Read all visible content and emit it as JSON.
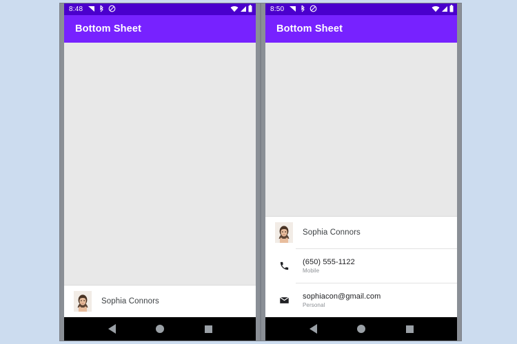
{
  "background_color": "#ccdcef",
  "theme": {
    "appbar_color": "#7722ff",
    "statusbar_color": "#4a00cc",
    "sheet_color": "#ffffff",
    "content_color": "#e8e8e8",
    "navbar_color": "#000000",
    "nav_icon_color": "#9aa0a6",
    "primary_text_color": "#202124",
    "secondary_text_color": "#8b8f94"
  },
  "phones": [
    {
      "id": "collapsed",
      "status_bar": {
        "clock": "8:48",
        "left_icons": [
          "signal-flag-icon",
          "bluetooth-icon",
          "do-not-disturb-icon"
        ],
        "right_icons": [
          "wifi-icon",
          "cellular-signal-icon",
          "battery-icon"
        ]
      },
      "app_bar": {
        "title": "Bottom Sheet"
      },
      "bottom_sheet": {
        "state": "collapsed",
        "contact": {
          "name": "Sophia Connors",
          "avatar": "contact-photo"
        },
        "details": []
      },
      "nav_bar": {
        "back_label": "Back",
        "home_label": "Home",
        "recents_label": "Recents"
      }
    },
    {
      "id": "expanded",
      "status_bar": {
        "clock": "8:50",
        "left_icons": [
          "signal-flag-icon",
          "bluetooth-icon",
          "do-not-disturb-icon"
        ],
        "right_icons": [
          "wifi-icon",
          "cellular-signal-icon",
          "battery-icon"
        ]
      },
      "app_bar": {
        "title": "Bottom Sheet"
      },
      "bottom_sheet": {
        "state": "expanded",
        "contact": {
          "name": "Sophia Connors",
          "avatar": "contact-photo"
        },
        "details": [
          {
            "icon": "phone-icon",
            "primary": "(650) 555-1122",
            "secondary": "Mobile"
          },
          {
            "icon": "email-icon",
            "primary": "sophiacon@gmail.com",
            "secondary": "Personal"
          }
        ]
      },
      "nav_bar": {
        "back_label": "Back",
        "home_label": "Home",
        "recents_label": "Recents"
      }
    }
  ]
}
